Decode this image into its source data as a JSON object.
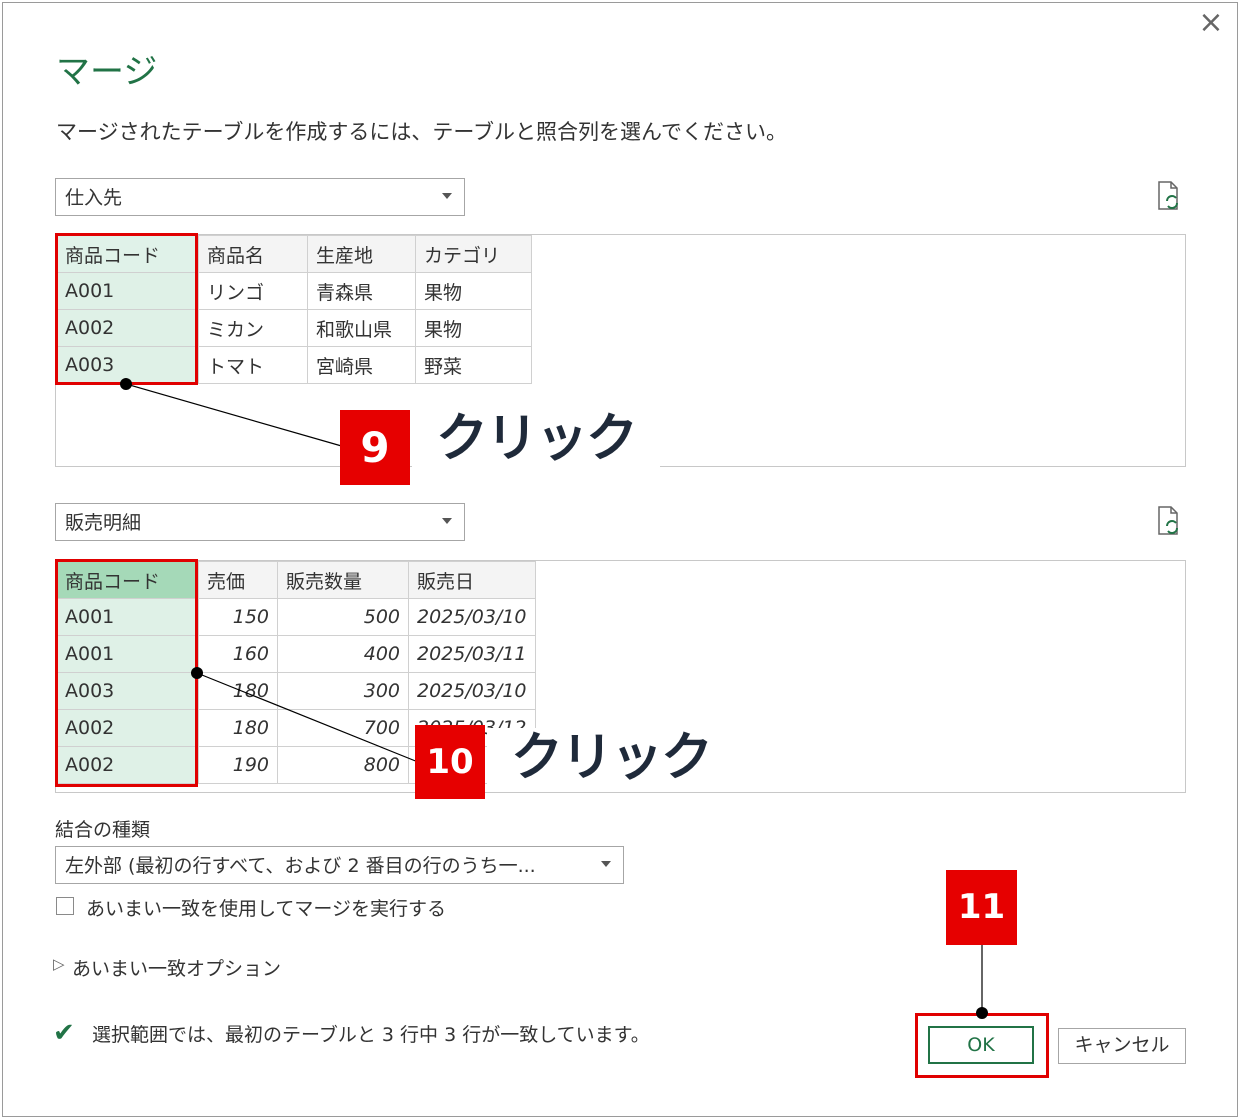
{
  "dialog": {
    "title": "マージ",
    "description": "マージされたテーブルを作成するには、テーブルと照合列を選んでください。",
    "close_glyph": "×"
  },
  "table1": {
    "selected": "仕入先",
    "headers": [
      "商品コード",
      "商品名",
      "生産地",
      "カテゴリ"
    ],
    "rows": [
      [
        "A001",
        "リンゴ",
        "青森県",
        "果物"
      ],
      [
        "A002",
        "ミカン",
        "和歌山県",
        "果物"
      ],
      [
        "A003",
        "トマト",
        "宮崎県",
        "野菜"
      ]
    ]
  },
  "table2": {
    "selected": "販売明細",
    "headers": [
      "商品コード",
      "売価",
      "販売数量",
      "販売日"
    ],
    "rows": [
      [
        "A001",
        "150",
        "500",
        "2025/03/10"
      ],
      [
        "A001",
        "160",
        "400",
        "2025/03/11"
      ],
      [
        "A003",
        "180",
        "300",
        "2025/03/10"
      ],
      [
        "A002",
        "180",
        "700",
        "2025/03/12"
      ],
      [
        "A002",
        "190",
        "800",
        ""
      ]
    ]
  },
  "join": {
    "label": "結合の種類",
    "selected": "左外部 (最初の行すべて、および 2 番目の行のうち一..."
  },
  "fuzzy": {
    "checkbox_label": "あいまい一致を使用してマージを実行する",
    "options_label": "あいまい一致オプション",
    "expander_glyph": "▷"
  },
  "status": {
    "check_glyph": "✔",
    "text": "選択範囲では、最初のテーブルと 3 行中 3 行が一致しています。"
  },
  "buttons": {
    "ok": "OK",
    "cancel": "キャンセル"
  },
  "annotations": {
    "step9": "9",
    "step10": "10",
    "step11": "11",
    "click_label": "クリック"
  },
  "colors": {
    "accent": "#217346",
    "annotation_red": "#e60000",
    "key_column": "#dff1e7"
  }
}
